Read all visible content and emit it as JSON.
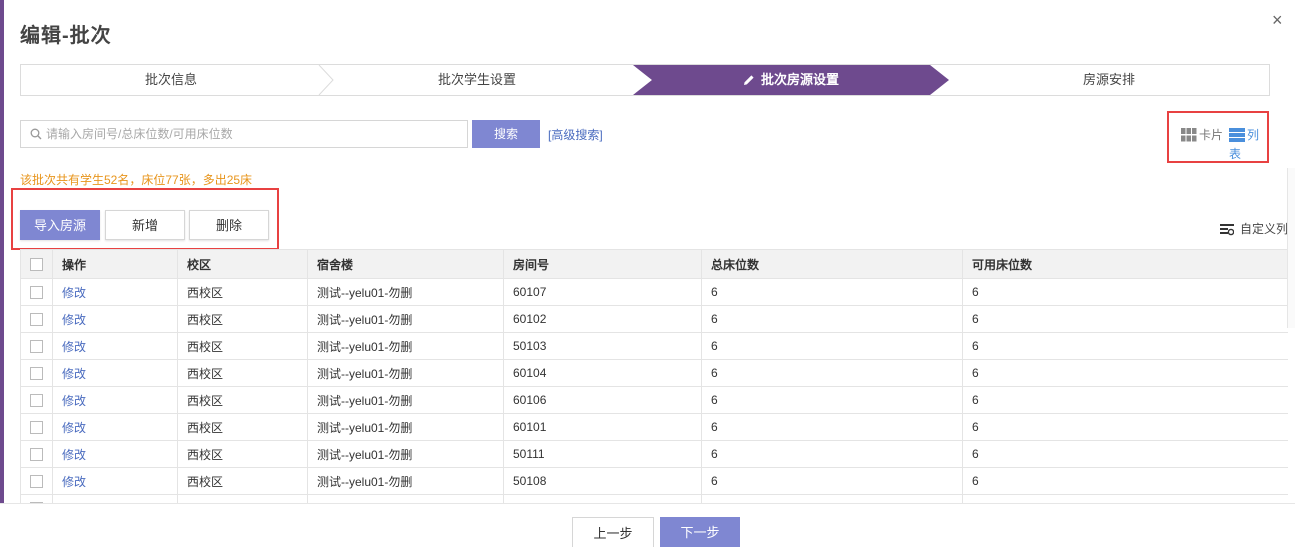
{
  "dialog": {
    "title": "编辑-批次",
    "close_label": "×"
  },
  "steps": [
    {
      "label": "批次信息",
      "active": false
    },
    {
      "label": "批次学生设置",
      "active": false
    },
    {
      "label": "批次房源设置",
      "active": true
    },
    {
      "label": "房源安排",
      "active": false
    }
  ],
  "search": {
    "placeholder": "请输入房间号/总床位数/可用床位数",
    "value": "",
    "button_label": "搜索",
    "advanced_label": "[高级搜索]"
  },
  "view_toggle": {
    "card_label": "卡片",
    "list_label": "列表",
    "selected": "list"
  },
  "summary_text": "该批次共有学生52名，床位77张，多出25床",
  "actions": {
    "import_label": "导入房源",
    "add_label": "新增",
    "delete_label": "删除"
  },
  "custom_columns_label": "自定义列",
  "table": {
    "headers": [
      "操作",
      "校区",
      "宿舍楼",
      "房间号",
      "总床位数",
      "可用床位数"
    ],
    "rows": [
      {
        "action": "修改",
        "campus": "西校区",
        "building": "测试--yelu01-勿删",
        "room": "60107",
        "total_beds": "6",
        "available_beds": "6"
      },
      {
        "action": "修改",
        "campus": "西校区",
        "building": "测试--yelu01-勿删",
        "room": "60102",
        "total_beds": "6",
        "available_beds": "6"
      },
      {
        "action": "修改",
        "campus": "西校区",
        "building": "测试--yelu01-勿删",
        "room": "50103",
        "total_beds": "6",
        "available_beds": "6"
      },
      {
        "action": "修改",
        "campus": "西校区",
        "building": "测试--yelu01-勿删",
        "room": "60104",
        "total_beds": "6",
        "available_beds": "6"
      },
      {
        "action": "修改",
        "campus": "西校区",
        "building": "测试--yelu01-勿删",
        "room": "60106",
        "total_beds": "6",
        "available_beds": "6"
      },
      {
        "action": "修改",
        "campus": "西校区",
        "building": "测试--yelu01-勿删",
        "room": "60101",
        "total_beds": "6",
        "available_beds": "6"
      },
      {
        "action": "修改",
        "campus": "西校区",
        "building": "测试--yelu01-勿删",
        "room": "50111",
        "total_beds": "6",
        "available_beds": "6"
      },
      {
        "action": "修改",
        "campus": "西校区",
        "building": "测试--yelu01-勿删",
        "room": "50108",
        "total_beds": "6",
        "available_beds": "6"
      },
      {
        "action": "",
        "campus": "",
        "building": "",
        "room": "",
        "total_beds": "",
        "available_beds": ""
      }
    ]
  },
  "footer": {
    "prev_label": "上一步",
    "next_label": "下一步"
  },
  "colors": {
    "accent_purple": "#6e4a8e",
    "button_blue": "#7f87d2",
    "link_blue": "#4a6bbf",
    "summary_orange": "#e8951c",
    "highlight_red": "#e84141"
  },
  "icons": {
    "search": "magnifier-icon",
    "edit": "pencil-icon",
    "card": "grid-icon",
    "list": "list-icon",
    "custom_columns": "column-settings-icon"
  }
}
